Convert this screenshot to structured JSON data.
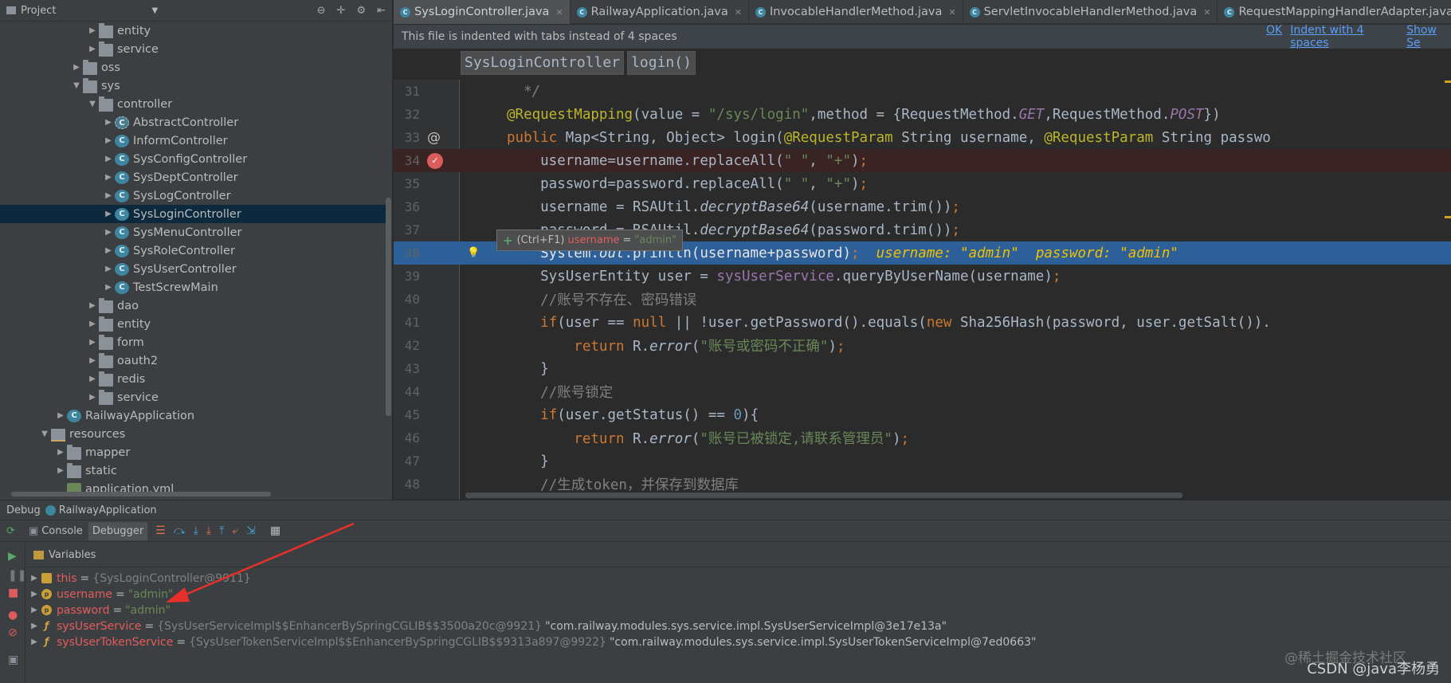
{
  "project": {
    "title": "Project",
    "tree": [
      {
        "label": "entity",
        "kind": "folder",
        "depth": 3,
        "expanded": false
      },
      {
        "label": "service",
        "kind": "folder",
        "depth": 3,
        "expanded": false
      },
      {
        "label": "oss",
        "kind": "folder",
        "depth": 2,
        "expanded": false
      },
      {
        "label": "sys",
        "kind": "folder",
        "depth": 2,
        "expanded": true
      },
      {
        "label": "controller",
        "kind": "folder",
        "depth": 3,
        "expanded": true
      },
      {
        "label": "AbstractController",
        "kind": "abstract",
        "depth": 4,
        "expanded": false
      },
      {
        "label": "InformController",
        "kind": "class",
        "depth": 4,
        "expanded": false
      },
      {
        "label": "SysConfigController",
        "kind": "class",
        "depth": 4,
        "expanded": false
      },
      {
        "label": "SysDeptController",
        "kind": "class",
        "depth": 4,
        "expanded": false
      },
      {
        "label": "SysLogController",
        "kind": "class",
        "depth": 4,
        "expanded": false
      },
      {
        "label": "SysLoginController",
        "kind": "class",
        "depth": 4,
        "expanded": false,
        "selected": true
      },
      {
        "label": "SysMenuController",
        "kind": "class",
        "depth": 4,
        "expanded": false
      },
      {
        "label": "SysRoleController",
        "kind": "class",
        "depth": 4,
        "expanded": false
      },
      {
        "label": "SysUserController",
        "kind": "class",
        "depth": 4,
        "expanded": false
      },
      {
        "label": "TestScrewMain",
        "kind": "class",
        "depth": 4,
        "expanded": false
      },
      {
        "label": "dao",
        "kind": "folder",
        "depth": 3,
        "expanded": false
      },
      {
        "label": "entity",
        "kind": "folder",
        "depth": 3,
        "expanded": false
      },
      {
        "label": "form",
        "kind": "folder",
        "depth": 3,
        "expanded": false
      },
      {
        "label": "oauth2",
        "kind": "folder",
        "depth": 3,
        "expanded": false
      },
      {
        "label": "redis",
        "kind": "folder",
        "depth": 3,
        "expanded": false
      },
      {
        "label": "service",
        "kind": "folder",
        "depth": 3,
        "expanded": false
      },
      {
        "label": "RailwayApplication",
        "kind": "app",
        "depth": 1,
        "expanded": false
      },
      {
        "label": "resources",
        "kind": "resources",
        "depth": 0,
        "expanded": true
      },
      {
        "label": "mapper",
        "kind": "folder",
        "depth": 1,
        "expanded": false
      },
      {
        "label": "static",
        "kind": "folder",
        "depth": 1,
        "expanded": false
      },
      {
        "label": "application.yml",
        "kind": "yml",
        "depth": 1,
        "leaf": true
      }
    ]
  },
  "tabs": [
    {
      "label": "SysLoginController.java",
      "active": true
    },
    {
      "label": "RailwayApplication.java",
      "active": false
    },
    {
      "label": "InvocableHandlerMethod.java",
      "active": false
    },
    {
      "label": "ServletInvocableHandlerMethod.java",
      "active": false
    },
    {
      "label": "RequestMappingHandlerAdapter.java",
      "active": false
    }
  ],
  "notice": {
    "text": "This file is indented with tabs instead of 4 spaces",
    "ok": "OK",
    "indent": "Indent with 4 spaces",
    "show": "Show Se"
  },
  "breadcrumb": [
    "SysLoginController",
    "login()"
  ],
  "code": [
    {
      "n": "31",
      "html": "  <span class='c i'>*/</span>"
    },
    {
      "n": "32",
      "html": "<span class='a'>@RequestMapping</span>(value = <span class='s'>\"/sys/login\"</span>,method = {RequestMethod.<span class='f i'>GET</span>,RequestMethod.<span class='f i'>POST</span>})"
    },
    {
      "n": "33",
      "html": "<span class='k'>public</span> Map&lt;String, Object&gt; login(<span class='a'>@RequestParam</span> String username, <span class='a'>@RequestParam</span> String passwo"
    },
    {
      "n": "34",
      "html": "    username=username.replaceAll(<span class='s'>\" \"</span>, <span class='s'>\"+\"</span>)<span class='k'>;</span>",
      "bp": true
    },
    {
      "n": "35",
      "html": "    password=password.replaceAll(<span class='s'>\" \"</span>, <span class='s'>\"+\"</span>)<span class='k'>;</span>"
    },
    {
      "n": "36",
      "html": "    username = RSAUtil.<span class='i'>decryptBase64</span>(username.trim())<span class='k'>;</span>"
    },
    {
      "n": "37",
      "html": "    password = RSAUtil.<span class='i'>decryptBase64</span>(password.trim())<span class='k'>;</span>"
    },
    {
      "n": "38",
      "html": "    System.<span class='i'>out</span>.println(username+password)<span class='k'>;</span>  <span class='inl-n'>username: </span><span class='inl-v'>\"admin\"</span>  <span class='inl-n'>password: </span><span class='inl-v'>\"admin\"</span>",
      "exec": true
    },
    {
      "n": "39",
      "html": "    SysUserEntity user = <span class='f'>sysUserService</span>.queryByUserName(username)<span class='k'>;</span>"
    },
    {
      "n": "40",
      "html": "    <span class='c'>//账号不存在、密码错误</span>"
    },
    {
      "n": "41",
      "html": "    <span class='k'>if</span>(user == <span class='k'>null</span> || !user.getPassword().equals(<span class='k'>new</span> Sha256Hash(password, user.getSalt())."
    },
    {
      "n": "42",
      "html": "        <span class='k'>return</span> R.<span class='i'>error</span>(<span class='s'>\"账号或密码不正确\"</span>)<span class='k'>;</span>"
    },
    {
      "n": "43",
      "html": "    }"
    },
    {
      "n": "44",
      "html": "    <span class='c'>//账号锁定</span>"
    },
    {
      "n": "45",
      "html": "    <span class='k'>if</span>(user.getStatus() == <span class='n'>0</span>){"
    },
    {
      "n": "46",
      "html": "        <span class='k'>return</span> R.<span class='i'>error</span>(<span class='s'>\"账号已被锁定,请联系管理员\"</span>)<span class='k'>;</span>"
    },
    {
      "n": "47",
      "html": "    }"
    },
    {
      "n": "48",
      "html": "    <span class='c'>//生成token，并保存到数据库</span>"
    }
  ],
  "tooltip": {
    "shortcut": "(Ctrl+F1)",
    "name": "username",
    "eq": "=",
    "value": "\"admin\""
  },
  "debug": {
    "title": "Debug",
    "config": "RailwayApplication",
    "console_tab": "Console",
    "debugger_tab": "Debugger",
    "variables_label": "Variables",
    "variables": [
      {
        "name": "this",
        "value": "{SysLoginController@9911}",
        "desc": "",
        "icon": "field"
      },
      {
        "name": "username",
        "value": "\"admin\"",
        "desc": "",
        "icon": "param",
        "str": true
      },
      {
        "name": "password",
        "value": "\"admin\"",
        "desc": "",
        "icon": "param",
        "str": true
      },
      {
        "name": "sysUserService",
        "value": "{SysUserServiceImpl$$EnhancerBySpringCGLIB$$3500a20c@9921}",
        "desc": "\"com.railway.modules.sys.service.impl.SysUserServiceImpl@3e17e13a\"",
        "icon": "field"
      },
      {
        "name": "sysUserTokenService",
        "value": "{SysUserTokenServiceImpl$$EnhancerBySpringCGLIB$$9313a897@9922}",
        "desc": "\"com.railway.modules.sys.service.impl.SysUserTokenServiceImpl@7ed0663\"",
        "icon": "field"
      }
    ]
  },
  "watermark": {
    "line1": "@稀土掘金技术社区",
    "line2": "CSDN @java李杨勇"
  },
  "colors": {
    "accent": "#2d6099",
    "breakpoint": "#db5c5c",
    "arrow": "#e8302a"
  }
}
